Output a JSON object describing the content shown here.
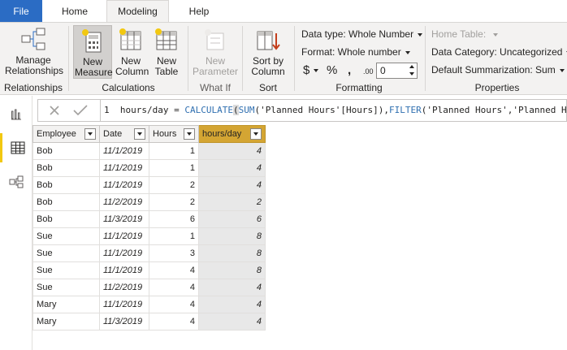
{
  "tabs": {
    "file": "File",
    "home": "Home",
    "modeling": "Modeling",
    "help": "Help"
  },
  "ribbon": {
    "manage_relationships": "Manage Relationships",
    "group_relationships": "Relationships",
    "new_measure": "New Measure",
    "new_column": "New Column",
    "new_table": "New Table",
    "group_calculations": "Calculations",
    "new_parameter": "New Parameter",
    "group_what_if": "What If",
    "sort_by_column": "Sort by Column",
    "group_sort": "Sort",
    "data_type": "Data type: Whole Number",
    "format": "Format: Whole number",
    "currency": "$",
    "percent": "%",
    "comma": ",",
    "decimal_icon": ".00",
    "decimal_value": "0",
    "group_formatting": "Formatting",
    "home_table": "Home Table:",
    "data_category": "Data Category: Uncategorized",
    "default_summarization": "Default Summarization: Sum",
    "group_properties": "Properties"
  },
  "formula_bar": {
    "line_number": "1",
    "prefix": "hours/day = ",
    "fn1": "CALCULATE",
    "paren1": "(",
    "fn2": "SUM",
    "arg1": "('Planned Hours'[Hours]),",
    "fn3": "FILTER",
    "arg2": "('Planned Hours','Planned Hours'[Employee]"
  },
  "table": {
    "columns": [
      "Employee",
      "Date",
      "Hours",
      "hours/day"
    ],
    "rows": [
      [
        "Bob",
        "11/1/2019",
        "1",
        "4"
      ],
      [
        "Bob",
        "11/1/2019",
        "1",
        "4"
      ],
      [
        "Bob",
        "11/1/2019",
        "2",
        "4"
      ],
      [
        "Bob",
        "11/2/2019",
        "2",
        "2"
      ],
      [
        "Bob",
        "11/3/2019",
        "6",
        "6"
      ],
      [
        "Sue",
        "11/1/2019",
        "1",
        "8"
      ],
      [
        "Sue",
        "11/1/2019",
        "3",
        "8"
      ],
      [
        "Sue",
        "11/1/2019",
        "4",
        "8"
      ],
      [
        "Sue",
        "11/2/2019",
        "4",
        "4"
      ],
      [
        "Mary",
        "11/1/2019",
        "4",
        "4"
      ],
      [
        "Mary",
        "11/3/2019",
        "4",
        "4"
      ]
    ]
  },
  "colors": {
    "file_tab": "#2b6cc4",
    "selected_column": "#d4a533",
    "active_rail": "#f2c811"
  }
}
